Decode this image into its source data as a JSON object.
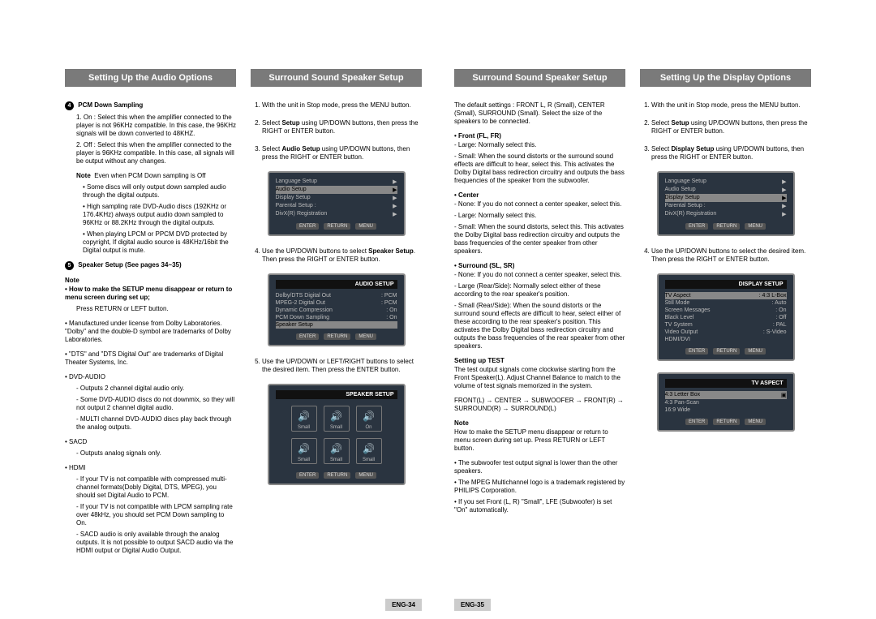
{
  "headers": {
    "audio_options": "Setting Up the Audio Options",
    "surround_setup": "Surround Sound Speaker Setup",
    "surround_setup2": "Surround Sound Speaker Setup",
    "display_options": "Setting Up the Display Options"
  },
  "col1": {
    "pcm_title": "PCM Down Sampling",
    "pcm_on": "1. On : Select this when the amplifier connected to the player is not 96KHz compatible. In this case, the 96KHz signals will be down converted to 48KHZ.",
    "pcm_off": "2. Off : Select this when the amplifier connected to the player is 96KHz compatible. In this case, all signals will be output without any changes.",
    "note_lbl": "Note",
    "note_even": "Even when PCM Down sampling is Off",
    "note_b1": "• Some discs will only output down sampled audio through the digital outputs.",
    "note_b2": "• High sampling rate DVD-Audio discs (192KHz or 176.4KHz) always output audio down sampled to 96KHz or 88.2KHz through the digital outputs.",
    "note_b3": "• When playing LPCM or PPCM DVD protected by copyright, If digital audio source is 48KHz/16bit the Digital output is mute.",
    "spk_title": "Speaker Setup (See pages 34~35)",
    "note2": "Note",
    "howto": "• How to make the SETUP menu disappear or return to menu screen during set up;",
    "howto_ans": "Press RETURN or LEFT button.",
    "dolby": "• Manufactured under license from Dolby Laboratories. \"Dolby\" and the double-D symbol are trademarks of Dolby Laboratories.",
    "dts": "• \"DTS\" and \"DTS Digital Out\" are trademarks of Digital Theater Systems, Inc.",
    "dvda": "• DVD-AUDIO",
    "dvda_1": "- Outputs 2 channel digital audio only.",
    "dvda_2": "- Some DVD-AUDIO discs do not downmix, so they will not output 2 channel digital audio.",
    "dvda_3": "- MULTI channel DVD-AUDIO discs play back through the analog outputs.",
    "sacd": "• SACD",
    "sacd_1": "- Outputs analog signals only.",
    "hdmi": "• HDMI",
    "hdmi_1": "- If your TV is not compatible with compressed multi-channel formats(Dobly Digital, DTS, MPEG), you should set Digital Audio to PCM.",
    "hdmi_2": "- If your TV is not compatible with LPCM sampling rate over 48kHz, you should set PCM Down sampling to On.",
    "hdmi_3": "- SACD audio is only available through the analog outputs. It is not possible to output SACD audio via the HDMI output or Digital Audio Output."
  },
  "col2": {
    "s1": "With the unit in Stop mode, press the MENU button.",
    "s2_a": "Select ",
    "s2_b": "Setup",
    "s2_c": " using UP/DOWN buttons, then press the RIGHT or ENTER button.",
    "s3_a": "Select ",
    "s3_b": "Audio Setup",
    "s3_c": " using UP/DOWN buttons, then press the RIGHT or ENTER button.",
    "s4_a": "Use the UP/DOWN buttons to select ",
    "s4_b": "Speaker Setup",
    "s4_c": ". Then press the RIGHT or ENTER button.",
    "s5": "Use the UP/DOWN or LEFT/RIGHT buttons to select the desired item. Then press the ENTER button.",
    "osd1_items": [
      "Language Setup",
      "Audio Setup",
      "Display Setup",
      "Parental Setup :",
      "DivX(R) Registration"
    ],
    "osd2_title": "AUDIO SETUP",
    "osd2_rows": [
      {
        "l": "Dolby/DTS Digital Out",
        "r": ": PCM"
      },
      {
        "l": "MPEG-2 Digital Out",
        "r": ": PCM"
      },
      {
        "l": "Dynamic Compression",
        "r": ": On"
      },
      {
        "l": "PCM Down Sampling",
        "r": ": On"
      },
      {
        "l": "Speaker Setup",
        "r": ""
      }
    ],
    "osd3_title": "SPEAKER SETUP",
    "osd3_sp": [
      {
        "icon": "🔊",
        "label": "Small"
      },
      {
        "icon": "🔊",
        "label": "Small"
      },
      {
        "icon": "🔊",
        "label": "On"
      },
      {
        "icon": "🔊",
        "label": "Small"
      },
      {
        "icon": "🔊",
        "label": "Small"
      },
      {
        "icon": "🔊",
        "label": "Small"
      }
    ],
    "ctrls": [
      "ENTER",
      "RETURN",
      "MENU"
    ]
  },
  "col3": {
    "defaults": "The default settings : FRONT L, R (Small), CENTER (Small), SURROUND (Small). Select the size of the speakers to be connected.",
    "front_t": "• Front (FL, FR)",
    "front_l": "- Large: Normally select this.",
    "front_s": "- Small: When the sound distorts or the surround sound effects are difficult to hear, select this. This activates the Dolby Digital bass redirection circuitry and outputs the bass frequencies of the speaker from the subwoofer.",
    "center_t": "• Center",
    "center_n": "- None: If you do not connect a center speaker, select this.",
    "center_l": "- Large: Normally select this.",
    "center_s": "- Small: When the sound distorts, select this. This activates the Dolby Digital bass redirection circuitry and outputs the bass frequencies of the center speaker from other speakers.",
    "surr_t": "• Surround (SL, SR)",
    "surr_n": "- None: If you do not connect a center speaker, select this.",
    "surr_l": "- Large (Rear/Side): Normally select either of these according to the rear speaker's position.",
    "surr_s": "- Small (Rear/Side): When the sound distorts or the surround sound effects are difficult to hear, select either of these according to the rear speaker's position. This activates the Dolby Digital bass redirection circuitry and outputs the bass frequencies of the rear speaker from other speakers.",
    "test_t": "Setting up TEST",
    "test_p": "The test output signals come clockwise starting from the Front Speaker(L). Adjust Channel Balance to match to the volume of test signals memorized in the system.",
    "test_chain": "FRONT(L) → CENTER → SUBWOOFER → FRONT(R) → SURROUND(R) → SURROUND(L)",
    "note_t": "Note",
    "note_p": "How to make the SETUP menu disappear or return to menu screen during set up. Press RETURN or LEFT button.",
    "note_b1": "• The subwoofer test output signal is lower than the other speakers.",
    "note_b2": "• The MPEG Multichannel logo is a trademark registered by PHILIPS Corporation.",
    "note_b3": "• If you set Front (L, R) \"Small\", LFE (Subwoofer) is set \"On\" automatically."
  },
  "col4": {
    "s1": "With the unit in Stop mode, press the MENU button.",
    "s2_a": "Select ",
    "s2_b": "Setup",
    "s2_c": " using UP/DOWN buttons, then press the RIGHT or ENTER button.",
    "s3_a": "Select ",
    "s3_b": "Display Setup",
    "s3_c": " using UP/DOWN buttons, then press the RIGHT or ENTER button.",
    "s4": "Use the UP/DOWN buttons to select the desired item. Then press the RIGHT or ENTER button.",
    "osd1_items": [
      "Language Setup",
      "Audio Setup",
      "Display Setup",
      "Parental Setup :",
      "DivX(R) Registration"
    ],
    "osd2_title": "DISPLAY SETUP",
    "osd2_rows": [
      {
        "l": "TV Aspect",
        "r": ": 4:3 L-Box"
      },
      {
        "l": "Still Mode",
        "r": ": Auto"
      },
      {
        "l": "Screen Messages",
        "r": ": On"
      },
      {
        "l": "Black Level",
        "r": ": Off"
      },
      {
        "l": "TV System",
        "r": ": PAL"
      },
      {
        "l": "Video Output",
        "r": ": S-Video"
      },
      {
        "l": "HDMI/DVI",
        "r": ""
      }
    ],
    "osd3_title": "TV ASPECT",
    "osd3_rows": [
      {
        "l": "4:3 Letter Box",
        "r": ""
      },
      {
        "l": "4:3 Pan-Scan",
        "r": ""
      },
      {
        "l": "16:9 Wide",
        "r": ""
      }
    ],
    "ctrls": [
      "ENTER",
      "RETURN",
      "MENU"
    ]
  },
  "footer": {
    "left": "ENG-34",
    "right": "ENG-35"
  }
}
